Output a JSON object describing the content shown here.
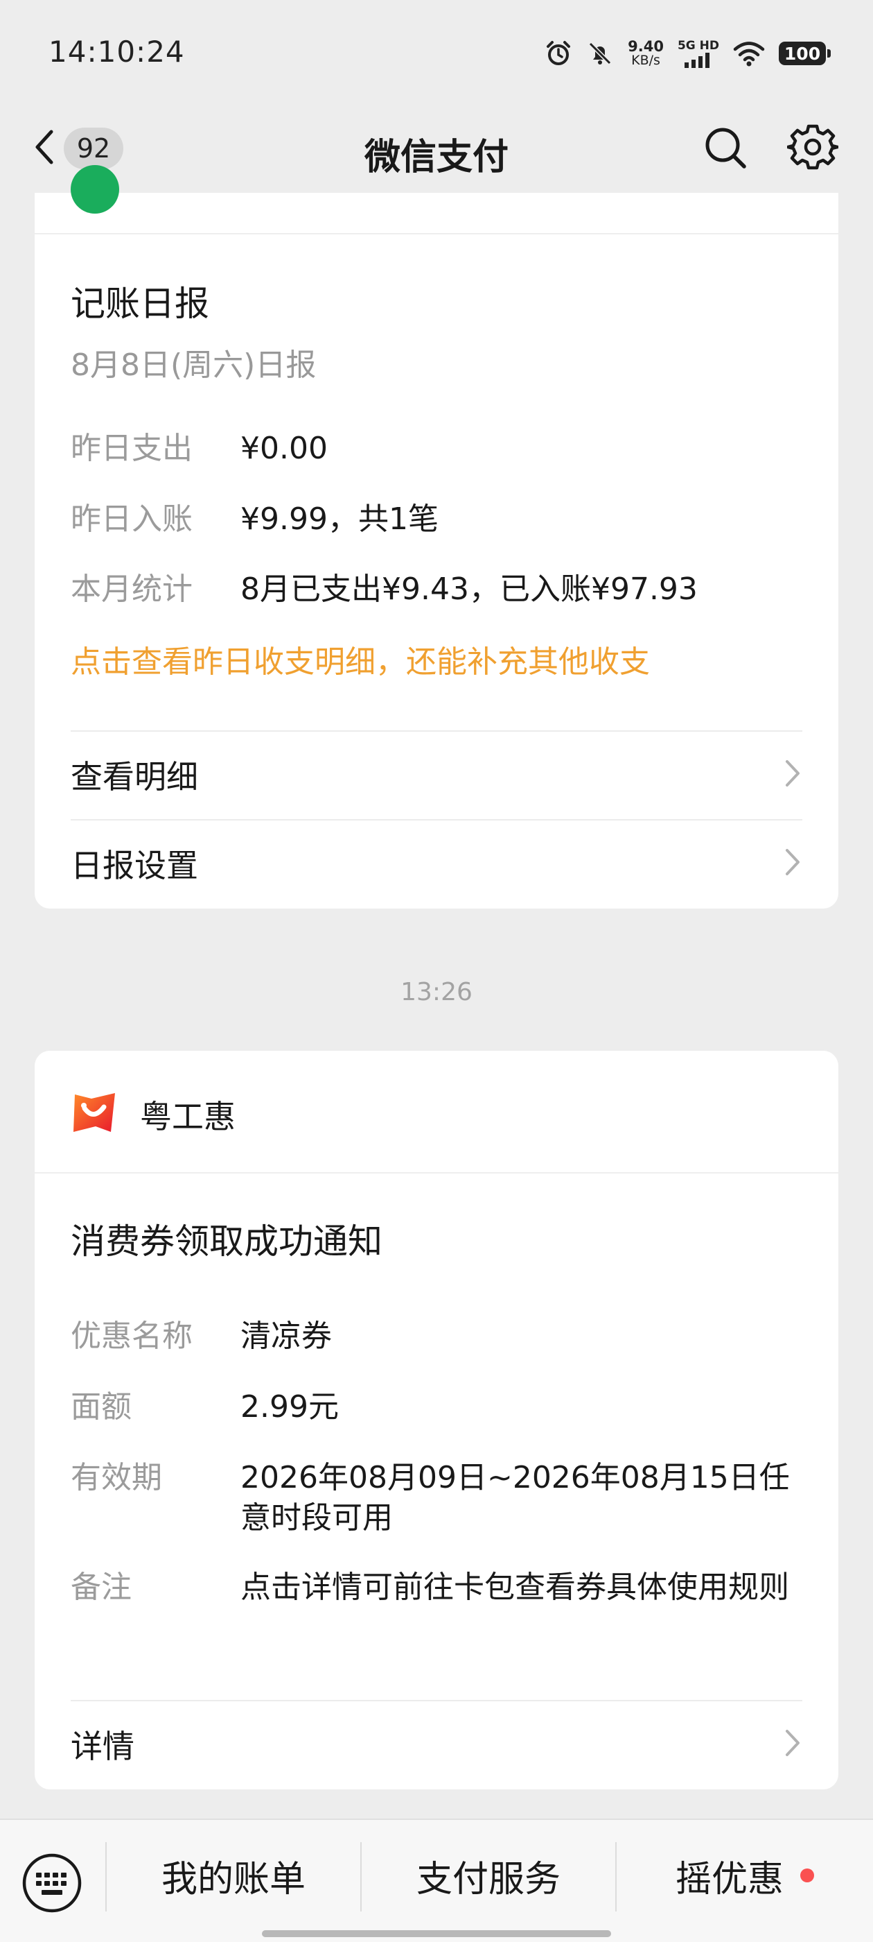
{
  "status_bar": {
    "time": "14:10:24",
    "net_speed_value": "9.40",
    "net_speed_unit": "KB/s",
    "signal_label": "5G HD",
    "battery": "100"
  },
  "nav": {
    "unread_count": "92",
    "title": "微信支付"
  },
  "daily_report": {
    "title": "记账日报",
    "subtitle": "8月8日(周六)日报",
    "rows": [
      {
        "label": "昨日支出",
        "value": "¥0.00"
      },
      {
        "label": "昨日入账",
        "value": "¥9.99，共1笔"
      },
      {
        "label": "本月统计",
        "value": "8月已支出¥9.43，已入账¥97.93"
      }
    ],
    "link_text": "点击查看昨日收支明细，还能补充其他收支",
    "actions": [
      {
        "label": "查看明细"
      },
      {
        "label": "日报设置"
      }
    ]
  },
  "message_time": "13:26",
  "coupon_notice": {
    "brand": "粤工惠",
    "title": "消费券领取成功通知",
    "rows": [
      {
        "label": "优惠名称",
        "value": "清凉券"
      },
      {
        "label": "面额",
        "value": "2.99元"
      },
      {
        "label": "有效期",
        "value": "2026年08月09日~2026年08月15日任意时段可用"
      },
      {
        "label": "备注",
        "value": "点击详情可前往卡包查看券具体使用规则"
      }
    ],
    "action_label": "详情"
  },
  "bottom_menu": {
    "items": [
      "我的账单",
      "支付服务",
      "摇优惠"
    ]
  },
  "colors": {
    "accent_orange": "#f0a030",
    "badge_red": "#fa5151",
    "brand_green": "#1aad5c",
    "background": "#ededed"
  }
}
